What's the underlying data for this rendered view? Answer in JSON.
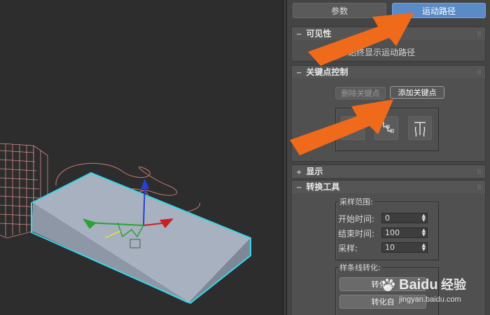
{
  "tabs": {
    "params": "参数",
    "motion_path": "运动路径"
  },
  "rollouts": {
    "visibility": {
      "title": "可见性",
      "option": "始终显示运动路径"
    },
    "key_control": {
      "title": "关键点控制",
      "delete_key": "删除关键点",
      "add_key": "添加关键点"
    },
    "display": {
      "title": "显示"
    },
    "conversion": {
      "title": "转换工具",
      "sample_range": "采样范围:",
      "start_time_label": "开始时间:",
      "start_time_value": "0",
      "end_time_label": "结束时间:",
      "end_time_value": "100",
      "samples_label": "采样:",
      "samples_value": "10",
      "spline_conversion": "样条线转化:",
      "convert_to": "转化为",
      "convert_from": "转化自"
    }
  },
  "watermark": {
    "brand": "Baidu",
    "sub": "经验",
    "url": "jingyan.baidu.com"
  },
  "colors": {
    "accent": "#5a8bc7",
    "arrow": "#ef6a1a",
    "selection": "#39d6e8"
  },
  "icons": [
    "gizmo-icon",
    "arrow-icon"
  ]
}
